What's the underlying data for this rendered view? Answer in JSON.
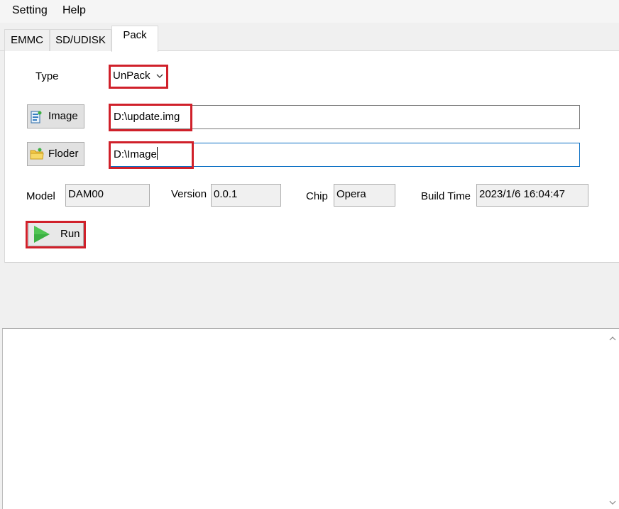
{
  "menu": {
    "items": [
      "Setting",
      "Help"
    ]
  },
  "tabs": [
    {
      "label": "EMMC",
      "active": false
    },
    {
      "label": "SD/UDISK",
      "active": false
    },
    {
      "label": "Pack",
      "active": true
    }
  ],
  "form": {
    "type_label": "Type",
    "type_value": "UnPack",
    "image_button": "Image",
    "image_path": "D:\\update.img",
    "folder_button": "Floder",
    "folder_path": "D:\\Image",
    "model_label": "Model",
    "model_value": "DAM00",
    "version_label": "Version",
    "version_value": "0.0.1",
    "chip_label": "Chip",
    "chip_value": "Opera",
    "build_time_label": "Build Time",
    "build_time_value": "2023/1/6 16:04:47",
    "run_button": "Run"
  },
  "icons": {
    "image_button": "image-file-icon",
    "folder_button": "folder-icon",
    "run_button": "play-icon",
    "type_dropdown": "chevron-down-icon",
    "scroll_up": "chevron-up-icon",
    "scroll_down": "chevron-down-icon"
  },
  "colors": {
    "highlight": "#d0202a",
    "focus_border": "#0a6fc4",
    "play": "#3cb043",
    "folder": "#f2c744"
  },
  "log": {
    "text": ""
  }
}
